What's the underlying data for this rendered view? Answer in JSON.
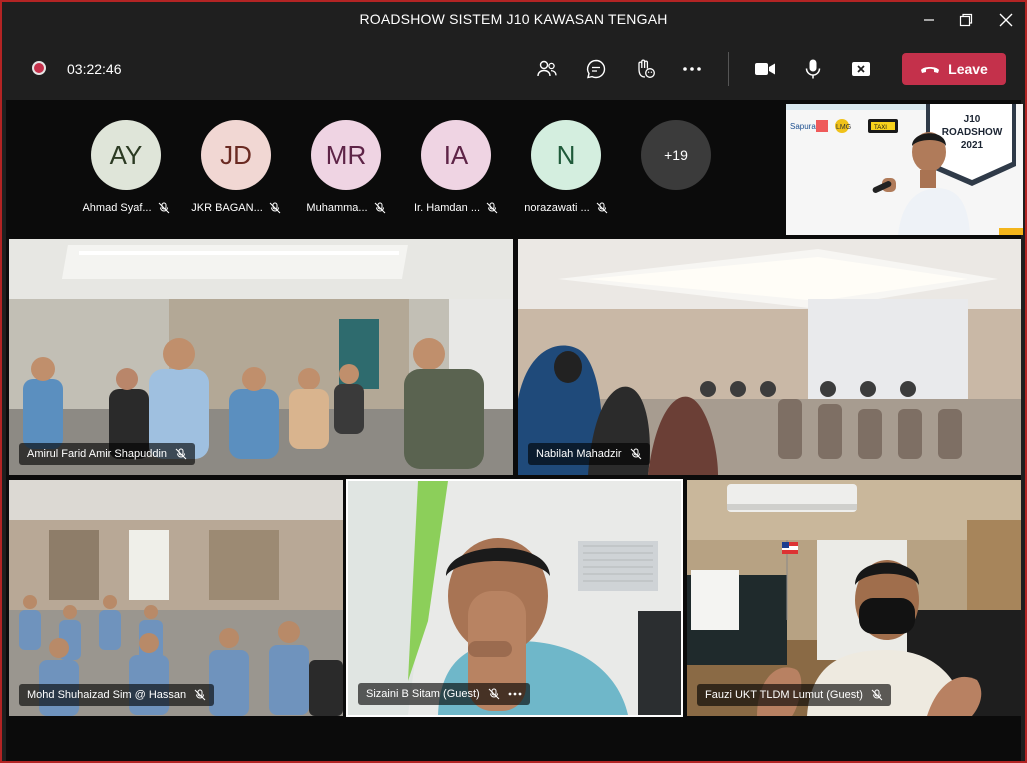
{
  "window": {
    "title": "ROADSHOW SISTEM J10 KAWASAN TENGAH"
  },
  "toolbar": {
    "timer": "03:22:46",
    "leave_label": "Leave",
    "icons": [
      "people-icon",
      "chat-icon",
      "raise-hand-icon",
      "more-icon",
      "camera-icon",
      "mic-icon",
      "share-icon"
    ],
    "leave_color": "#c4314b"
  },
  "participants": [
    {
      "initials": "AY",
      "name": "Ahmad Syaf...",
      "bg": "#dfe5d9",
      "fg": "#2b3a22"
    },
    {
      "initials": "JD",
      "name": "JKR BAGAN...",
      "bg": "#f1d7d3",
      "fg": "#6a2a22"
    },
    {
      "initials": "MR",
      "name": "Muhamma...",
      "bg": "#efd4e3",
      "fg": "#5e2447"
    },
    {
      "initials": "IA",
      "name": "Ir. Hamdan ...",
      "bg": "#efd4e3",
      "fg": "#5e2447"
    },
    {
      "initials": "N",
      "name": "norazawati ...",
      "bg": "#d4eedf",
      "fg": "#1f5a3a"
    }
  ],
  "more_participants": "+19",
  "shared_content": {
    "sign_lines": [
      "J10",
      "ROADSHOW",
      "2021"
    ],
    "logos": [
      "Sapura",
      "LMG",
      "TAXI"
    ]
  },
  "video_tiles": [
    {
      "name": "Amirul Farid Amir Shapuddin"
    },
    {
      "name": "Nabilah Mahadzir"
    },
    {
      "name": "Mohd Shuhaizad Sim @ Hassan"
    },
    {
      "name": "Sizaini B Sitam (Guest)"
    },
    {
      "name": "Fauzi UKT TLDM Lumut (Guest)"
    }
  ]
}
